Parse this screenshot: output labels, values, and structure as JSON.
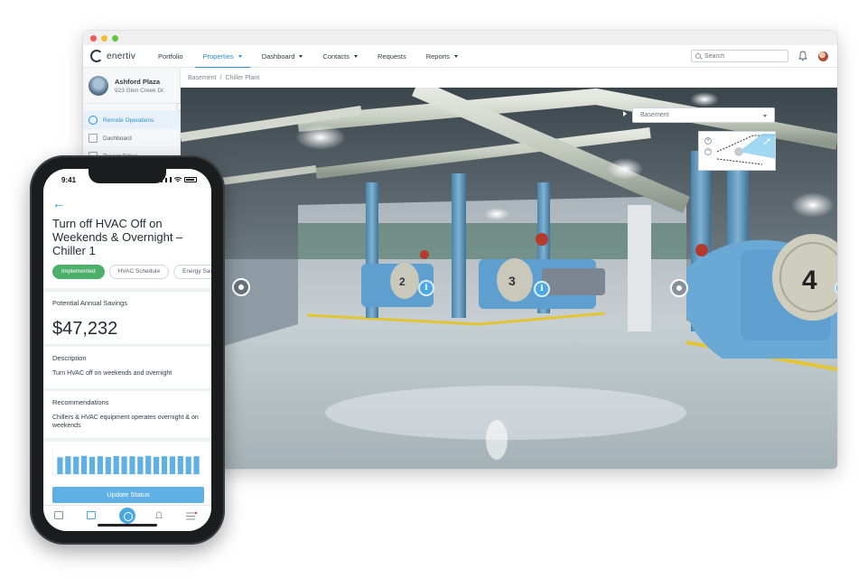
{
  "browser": {
    "logo_text": "enertiv",
    "nav": [
      {
        "label": "Portfolio",
        "dropdown": false,
        "active": false
      },
      {
        "label": "Properties",
        "dropdown": true,
        "active": true
      },
      {
        "label": "Dashboard",
        "dropdown": true,
        "active": false
      },
      {
        "label": "Contacts",
        "dropdown": true,
        "active": false
      },
      {
        "label": "Requests",
        "dropdown": false,
        "active": false
      },
      {
        "label": "Reports",
        "dropdown": true,
        "active": false
      }
    ],
    "search_placeholder": "Search",
    "accent_color": "#2a8fd4"
  },
  "sidebar": {
    "property_name": "Ashford Plaza",
    "property_address": "923 Glen Creek Dr.",
    "items": [
      {
        "label": "Remote Operations",
        "active": true
      },
      {
        "label": "Dashboard",
        "active": false
      },
      {
        "label": "Tenant Billing",
        "active": false
      }
    ]
  },
  "breadcrumb": {
    "level1": "Basement",
    "separator": "/",
    "level2": "Chiller Plant"
  },
  "viewer": {
    "floor_selected": "Basement",
    "zoom_in": "+",
    "zoom_out": "−",
    "hotspot_glyph": "i",
    "chiller_numbers": [
      "2",
      "3",
      "4"
    ]
  },
  "phone": {
    "time": "9:41",
    "back_glyph": "←",
    "title": "Turn off HVAC Off on Weekends & Overnight – Chiller 1",
    "chips": [
      {
        "label": "Implemented",
        "active": true
      },
      {
        "label": "HVAC Schedule",
        "active": false
      },
      {
        "label": "Energy Savi",
        "active": false
      }
    ],
    "savings_label": "Potential Annual Savings",
    "savings_value": "$47,232",
    "description_label": "Description",
    "description_text": "Turn HVAC off on weekends and overnight",
    "recommendations_label": "Recommendations",
    "recommendations_text": "Chillers & HVAC equipment operates overnight & on weekends",
    "update_button": "Update Status",
    "success_color": "#4caf6a",
    "button_color": "#5fb0e4"
  },
  "chart_data": {
    "type": "bar",
    "values": [
      0.85,
      0.9,
      0.88,
      0.92,
      0.87,
      0.9,
      0.86,
      0.91,
      0.89,
      0.9,
      0.88,
      0.92,
      0.87,
      0.9,
      0.89,
      0.91,
      0.88,
      0.9
    ]
  }
}
